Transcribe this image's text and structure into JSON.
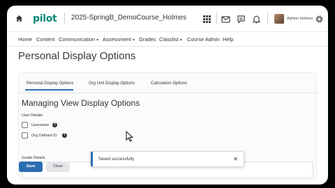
{
  "header": {
    "logo_text": "pilot",
    "course_title": "2025-SpringB_DemoCourse_Holmes",
    "user_name": "Ashton Holmes",
    "brand_color": "#0a8a7a",
    "icons": [
      "home-icon",
      "grid-icon",
      "mail-icon",
      "chat-icon",
      "bell-icon",
      "gear-icon"
    ]
  },
  "nav": {
    "items": [
      {
        "label": "Home",
        "dropdown": false
      },
      {
        "label": "Content",
        "dropdown": false
      },
      {
        "label": "Communication",
        "dropdown": true
      },
      {
        "label": "Assessment",
        "dropdown": true
      },
      {
        "label": "Grades",
        "dropdown": false
      },
      {
        "label": "Classlist",
        "dropdown": true
      },
      {
        "label": "Course Admin",
        "dropdown": false
      },
      {
        "label": "Help",
        "dropdown": false
      }
    ]
  },
  "page": {
    "title": "Personal Display Options"
  },
  "tabs": [
    {
      "label": "Personal Display Options",
      "active": true
    },
    {
      "label": "Org Unit Display Options",
      "active": false
    },
    {
      "label": "Calculation Options",
      "active": false
    }
  ],
  "section": {
    "heading": "Managing View Display Options",
    "user_details_label": "User Details",
    "checkboxes": [
      {
        "label": "Username",
        "checked": false
      },
      {
        "label": "Org Defined ID",
        "checked": false
      }
    ],
    "grade_details_label": "Grade Details"
  },
  "footer": {
    "save_label": "Save",
    "close_label": "Close"
  },
  "toast": {
    "message": "Saved successfully",
    "close_symbol": "✕"
  },
  "accent_color": "#2a6db0"
}
